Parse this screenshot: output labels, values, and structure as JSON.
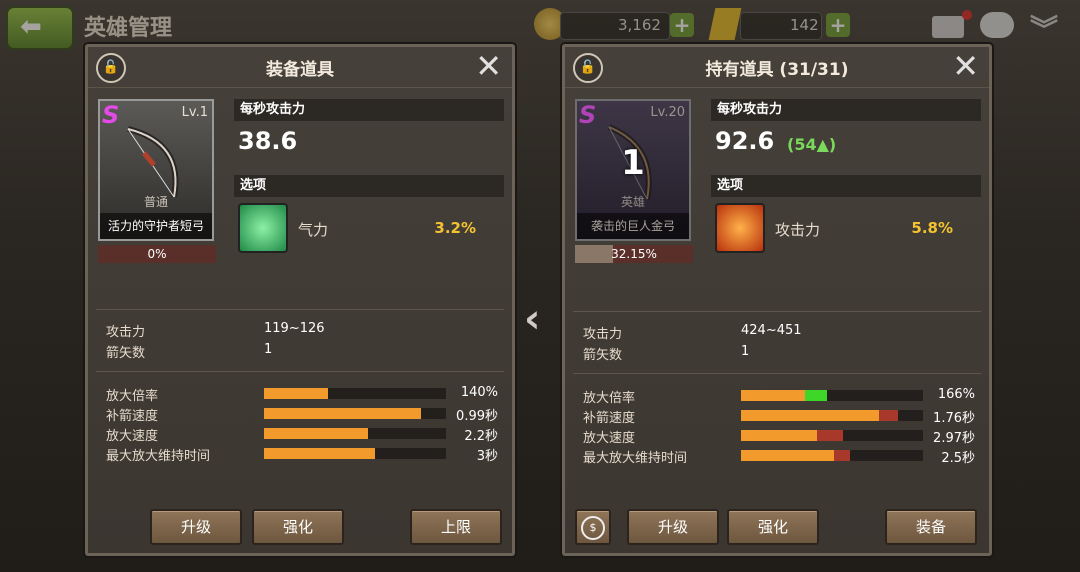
{
  "topbar": {
    "title": "英雄管理",
    "coins": "3,162",
    "gems": "142",
    "plus": "+"
  },
  "nav": {
    "swap_arrow": "‹"
  },
  "left_panel": {
    "title": "装备道具",
    "item": {
      "grade": "S",
      "level": "Lv.1",
      "rarity": "普通",
      "name": "活力的守护者短弓",
      "progress_text": "0%",
      "progress": 0
    },
    "dps_label": "每秒攻击力",
    "dps_value": "38.6",
    "options_label": "选项",
    "option": {
      "name": "气力",
      "value": "3.2%",
      "icon": "stamina-icon",
      "color": "#36c06a"
    },
    "stats": [
      {
        "label": "攻击力",
        "value": "119~126"
      },
      {
        "label": "箭矢数",
        "value": "1"
      }
    ],
    "bars": [
      {
        "label": "放大倍率",
        "value": "140%",
        "fill": 0.35
      },
      {
        "label": "补箭速度",
        "value": "0.99秒",
        "fill": 0.86
      },
      {
        "label": "放大速度",
        "value": "2.2秒",
        "fill": 0.57
      },
      {
        "label": "最大放大维持时间",
        "value": "3秒",
        "fill": 0.61
      }
    ],
    "buttons": {
      "upgrade": "升级",
      "enhance": "强化",
      "limit": "上限"
    }
  },
  "right_panel": {
    "title": "持有道具 (31/31)",
    "item": {
      "grade": "S",
      "level": "Lv.20",
      "rarity": "英雄",
      "name": "袭击的巨人金弓",
      "count": "1",
      "progress_text": "32.15%",
      "progress": 0.3215
    },
    "dps_label": "每秒攻击力",
    "dps_value": "92.6",
    "dps_diff": "(54▲)",
    "options_label": "选项",
    "option": {
      "name": "攻击力",
      "value": "5.8%",
      "icon": "attack-arrow-icon",
      "color": "#e0521a"
    },
    "stats": [
      {
        "label": "攻击力",
        "value": "424~451"
      },
      {
        "label": "箭矢数",
        "value": "1"
      }
    ],
    "bars": [
      {
        "label": "放大倍率",
        "value": "166%",
        "fill": 0.35,
        "extra": 0.12,
        "extra_color": "#3fd62a"
      },
      {
        "label": "补箭速度",
        "value": "1.76秒",
        "fill": 0.76,
        "extra": 0.1,
        "extra_color": "#a8382a"
      },
      {
        "label": "放大速度",
        "value": "2.97秒",
        "fill": 0.42,
        "extra": 0.14,
        "extra_color": "#a8382a"
      },
      {
        "label": "最大放大维持时间",
        "value": "2.5秒",
        "fill": 0.51,
        "extra": 0.09,
        "extra_color": "#a8382a"
      }
    ],
    "buttons": {
      "sell": "$",
      "upgrade": "升级",
      "enhance": "强化",
      "equip": "装备"
    }
  }
}
